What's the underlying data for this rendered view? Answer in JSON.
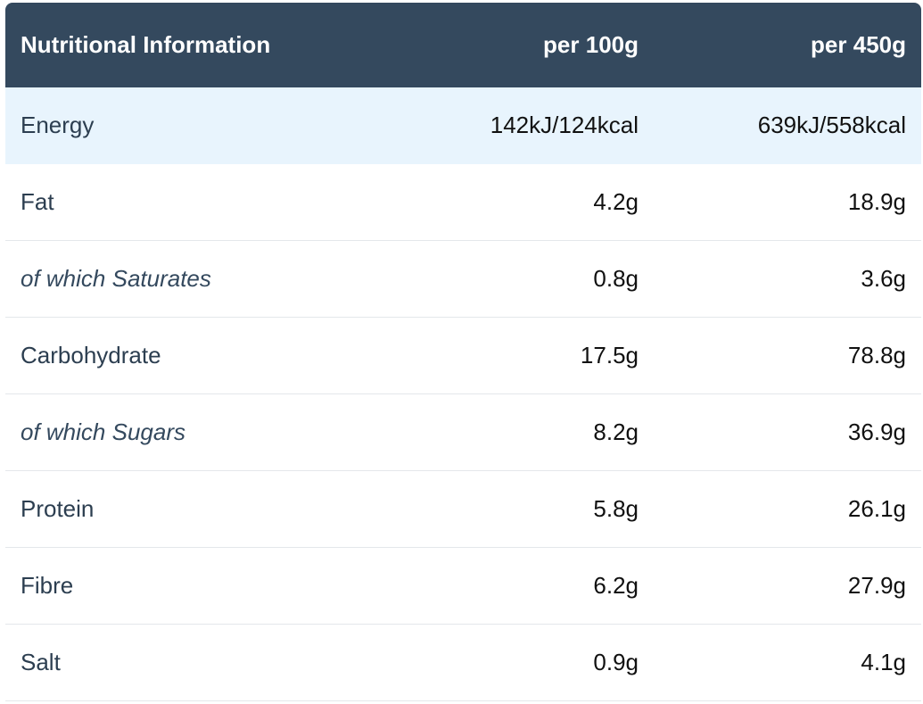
{
  "header": {
    "name": "Nutritional Information",
    "per100": "per 100g",
    "per450": "per 450g"
  },
  "rows": [
    {
      "name": "Energy",
      "per100": "142kJ/124kcal",
      "per450": "639kJ/558kcal",
      "highlight": true,
      "sub": false
    },
    {
      "name": "Fat",
      "per100": "4.2g",
      "per450": "18.9g",
      "highlight": false,
      "sub": false
    },
    {
      "name": "of which Saturates",
      "per100": "0.8g",
      "per450": "3.6g",
      "highlight": false,
      "sub": true
    },
    {
      "name": "Carbohydrate",
      "per100": "17.5g",
      "per450": "78.8g",
      "highlight": false,
      "sub": false
    },
    {
      "name": "of which Sugars",
      "per100": "8.2g",
      "per450": "36.9g",
      "highlight": false,
      "sub": true
    },
    {
      "name": "Protein",
      "per100": "5.8g",
      "per450": "26.1g",
      "highlight": false,
      "sub": false
    },
    {
      "name": "Fibre",
      "per100": "6.2g",
      "per450": "27.9g",
      "highlight": false,
      "sub": false
    },
    {
      "name": "Salt",
      "per100": "0.9g",
      "per450": "4.1g",
      "highlight": false,
      "sub": false
    }
  ],
  "colors": {
    "header_bg": "#34495e",
    "highlight_bg": "#e8f4fd",
    "divider": "#e4e7eb"
  }
}
